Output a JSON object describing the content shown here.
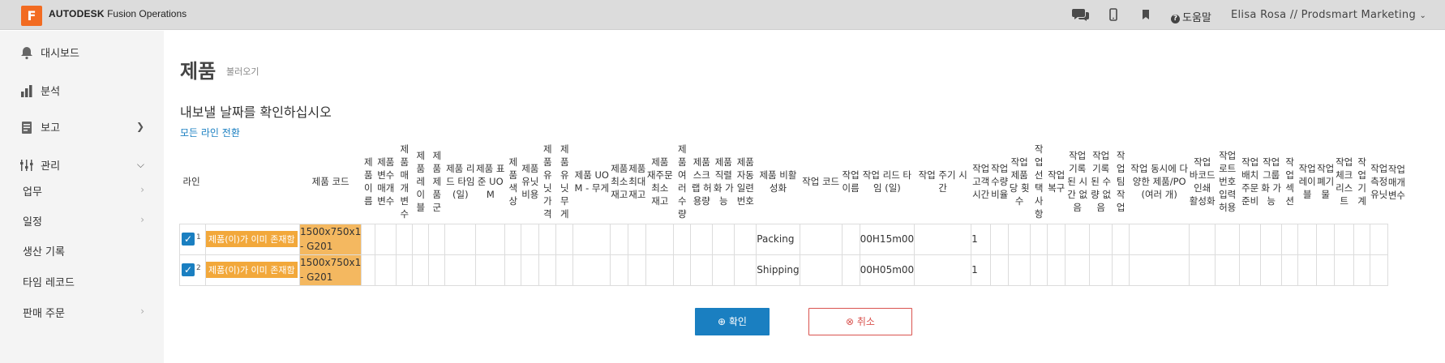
{
  "app": {
    "logo_letter": "F",
    "brand": "AUTODESK",
    "product": "Fusion Operations"
  },
  "topbar": {
    "help_label": "도움말",
    "user_label": "Elisa Rosa // Prodsmart Marketing"
  },
  "sidebar": {
    "main_items": [
      {
        "label": "대시보드",
        "icon": "bell-icon"
      },
      {
        "label": "분석",
        "icon": "bar-chart-icon"
      },
      {
        "label": "보고",
        "icon": "report-icon"
      },
      {
        "label": "관리",
        "icon": "manage-icon"
      }
    ],
    "sub_items": [
      {
        "label": "업무"
      },
      {
        "label": "일정"
      },
      {
        "label": "생산 기록"
      },
      {
        "label": "타임 레코드"
      },
      {
        "label": "판매 주문"
      }
    ]
  },
  "page": {
    "title": "제품",
    "subtitle": "불러오기",
    "confirm_text": "내보낼 날짜를 확인하십시오",
    "toggle_link": "모든 라인 전환"
  },
  "table": {
    "headers": [
      "라인",
      "제품 코드",
      "제품 이름",
      "제품 변수 매개 변수",
      "제품 매개 변수",
      "제품 레이블",
      "제품 제품군",
      "제품 리드 타임 (일)",
      "제품 표준 UOM",
      "제품 색상",
      "제품 유닛 비용",
      "제품 유닛 가격",
      "제품 유닛 무게",
      "제품 UOM - 무게",
      "제품 최소 재고",
      "제품 최대 재고",
      "제품 재주문 최소 재고",
      "제품 여러 수량",
      "제품 스크랩 허용량",
      "제품 직렬화 가능",
      "제품 자동 일련 번호",
      "제품 비활성화",
      "작업 코드",
      "작업 이름",
      "작업 리드 타임 (일)",
      "작업 주기 시간",
      "작업 고객 시간",
      "작업 수량 비율",
      "작업 제품당 횟수",
      "작업 선택 사항",
      "작업 복구",
      "작업 기록된 시간 없음",
      "작업 기록된 수량 없음",
      "작업 팀 작업",
      "작업 동시에 다양한 제품/PO(여러 개)",
      "작업 바코드 인쇄 활성화",
      "작업 로트 번호 입력 허용",
      "작업 배치 주문 준비",
      "작업 그룹화 가능",
      "작업 섹션",
      "작업 레이블",
      "작업 폐기물",
      "작업 체크리스트",
      "작업 기계",
      "작업 측정 유닛",
      "작업 매개 변수"
    ],
    "rows": [
      {
        "line_no": "1",
        "status": "제품(이)가 이미 존재함",
        "product_code": "1500x750x1 - G201",
        "op_code": "Packing",
        "cycle_time": "00H15m00",
        "qty_ratio": "1"
      },
      {
        "line_no": "2",
        "status": "제품(이)가 이미 존재함",
        "product_code": "1500x750x1 - G201",
        "op_code": "Shipping",
        "cycle_time": "00H05m00",
        "qty_ratio": "1"
      }
    ]
  },
  "buttons": {
    "ok_label": "확인",
    "cancel_label": "취소"
  },
  "colors": {
    "accent": "#1a7fc1",
    "orange": "#f26b21",
    "badge": "#f2a83b",
    "danger": "#d9534f"
  }
}
